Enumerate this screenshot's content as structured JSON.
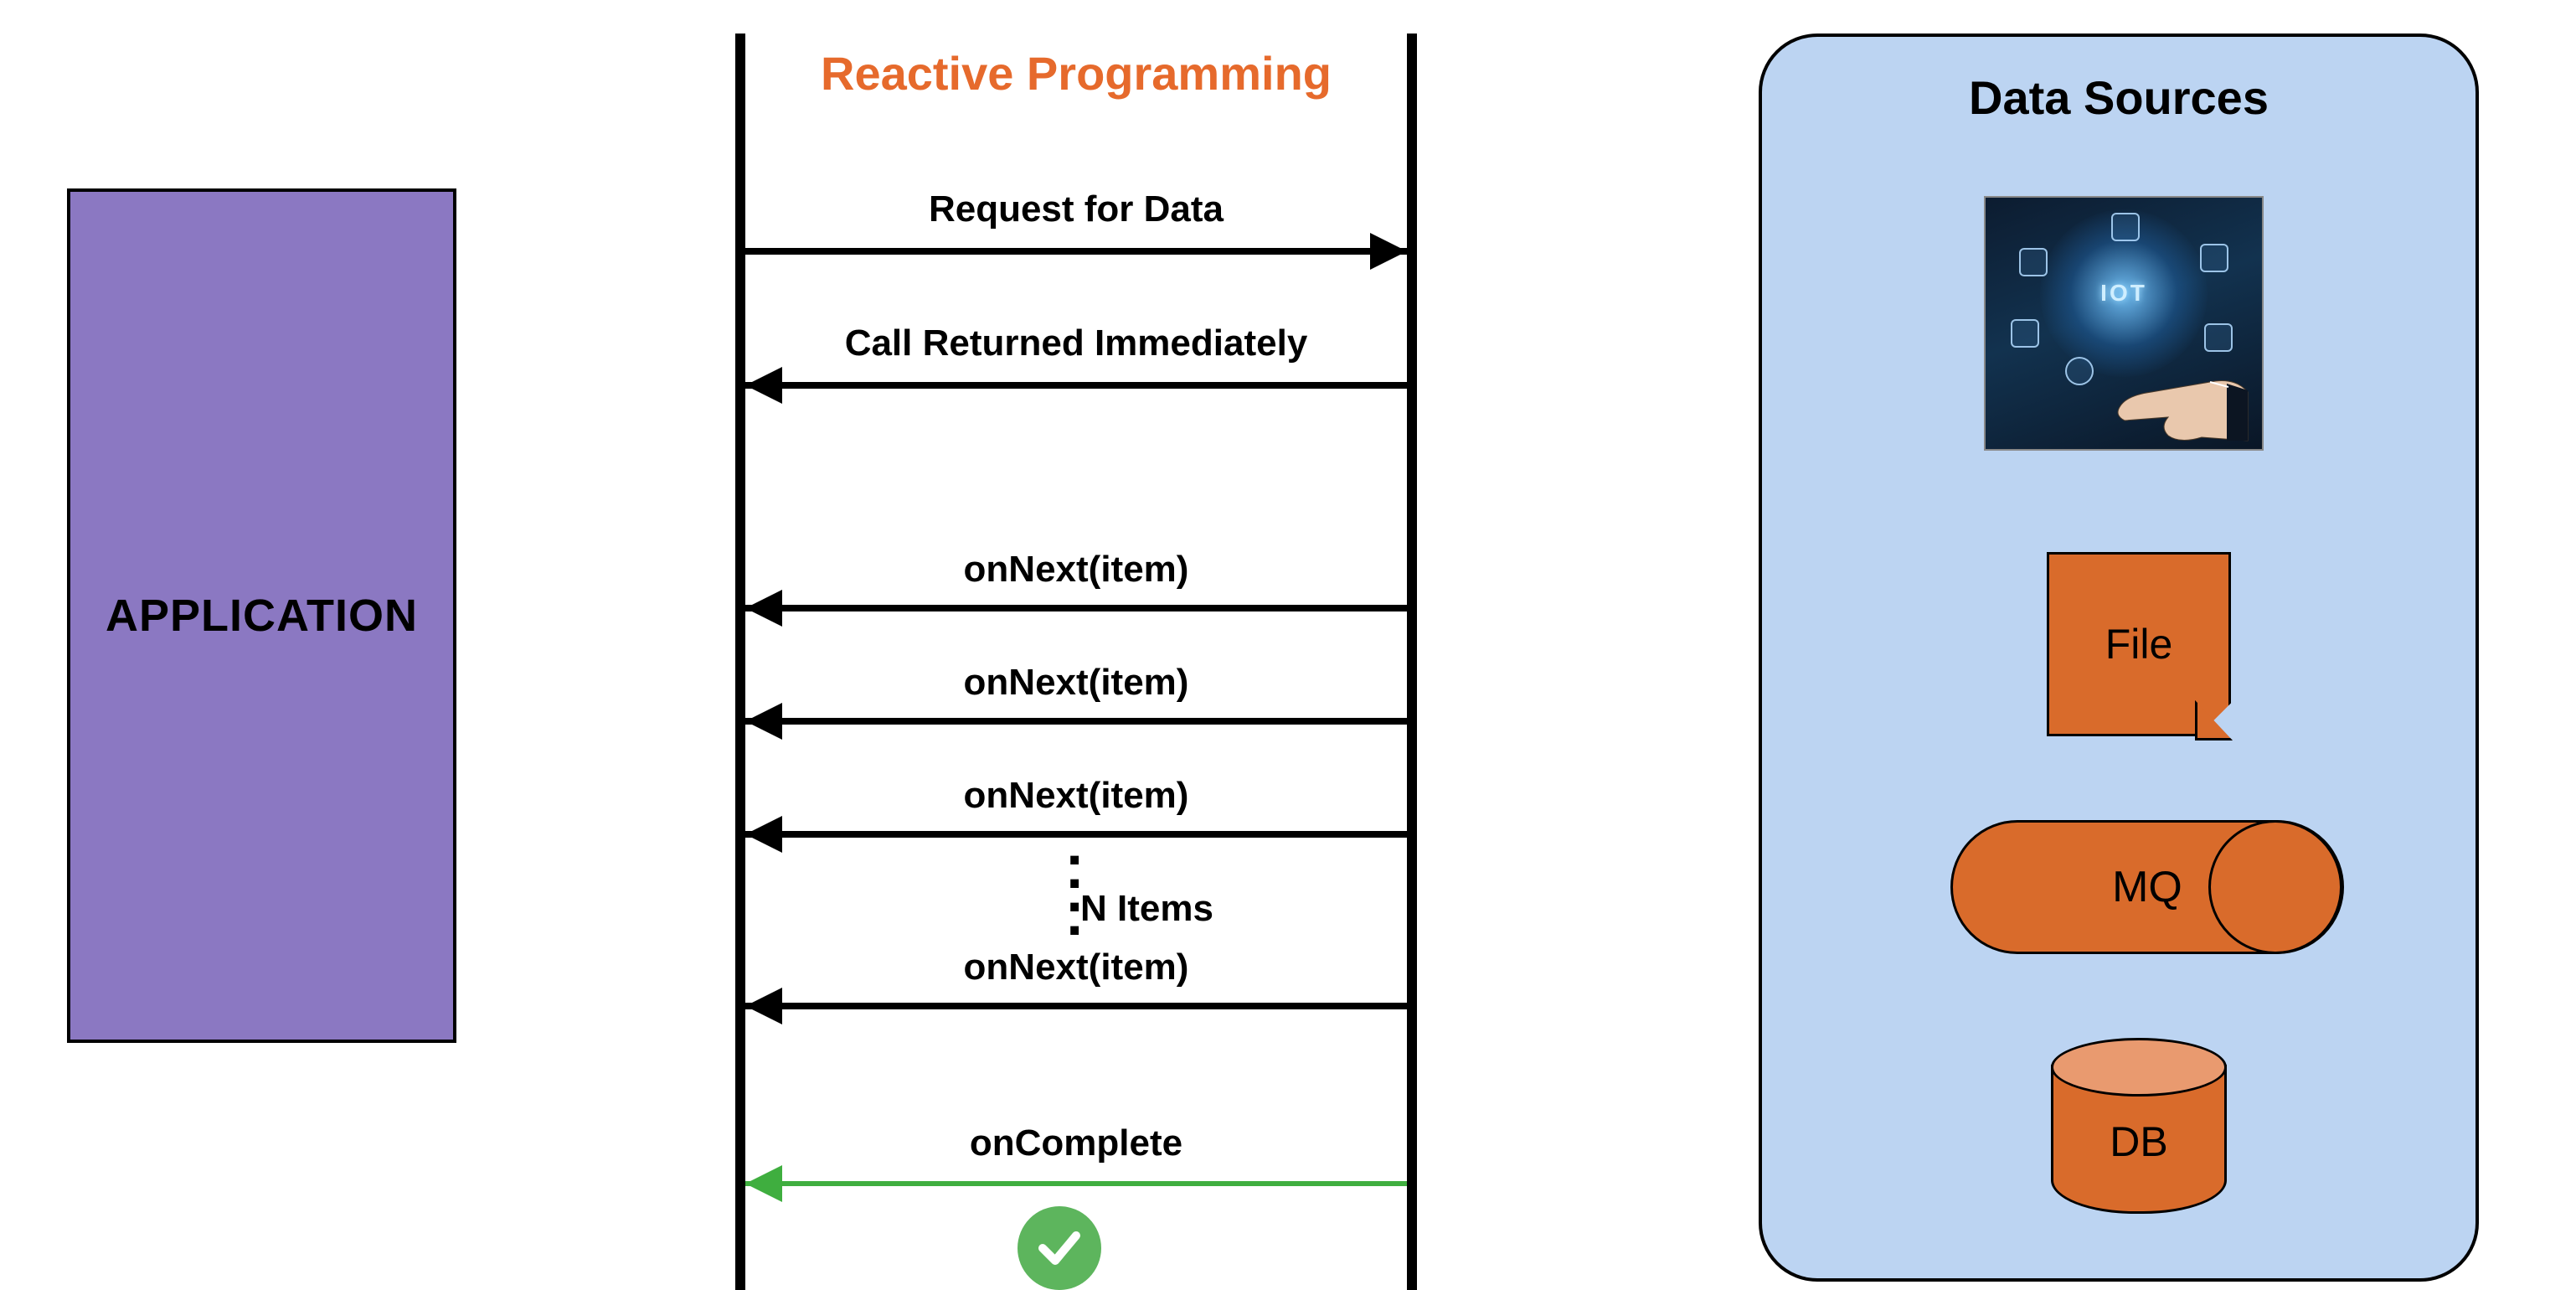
{
  "application": {
    "label": "APPLICATION"
  },
  "sequence": {
    "title": "Reactive Programming",
    "messages": {
      "request": "Request for Data",
      "returned": "Call Returned Immediately",
      "onNext1": "onNext(item)",
      "onNext2": "onNext(item)",
      "onNext3": "onNext(item)",
      "nItems": "N Items",
      "onNext4": "onNext(item)",
      "onComplete": "onComplete"
    }
  },
  "dataSources": {
    "title": "Data Sources",
    "iot": "IOT",
    "file": "File",
    "mq": "MQ",
    "db": "DB"
  },
  "colors": {
    "accent": "#e66a2c",
    "appBox": "#8b78c2",
    "panel": "#bcd4f2",
    "shape": "#d96b2b",
    "success": "#5db55d"
  }
}
